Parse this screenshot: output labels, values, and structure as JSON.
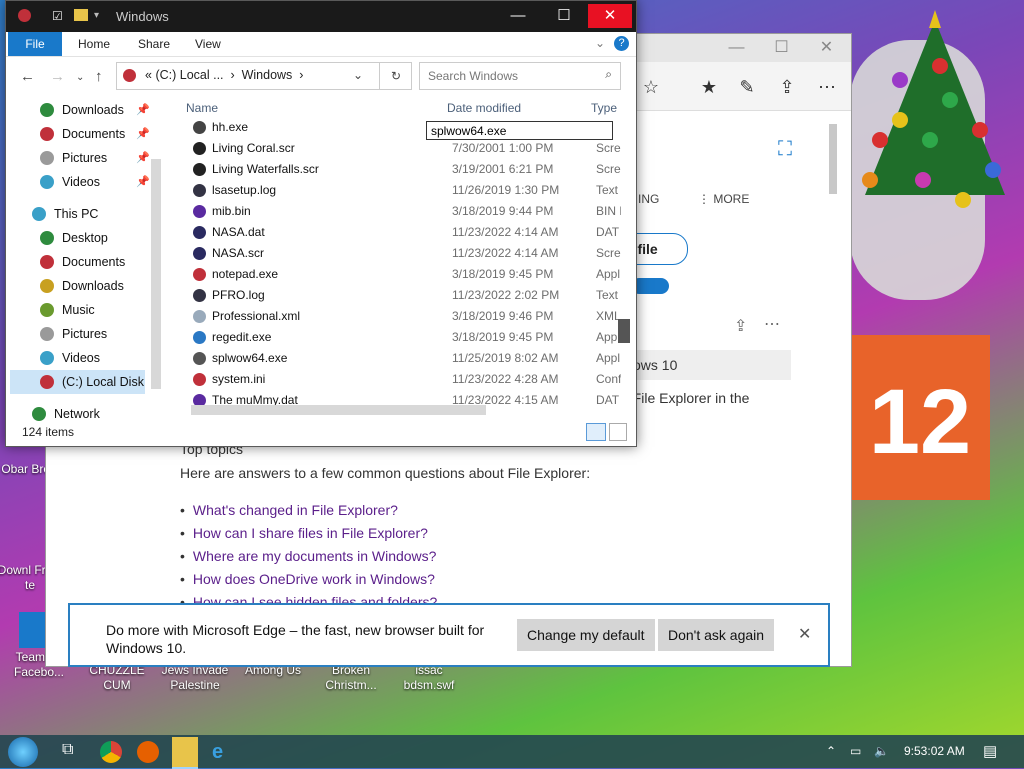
{
  "desktop": {
    "icons": [
      {
        "label": "Obar Brow"
      },
      {
        "label": "Downl From te"
      },
      {
        "label": "TeamOS Facebo..."
      },
      {
        "label": "CHUZZLE CUM"
      },
      {
        "label": "Jews Invade Palestine"
      },
      {
        "label": "Among Us"
      },
      {
        "label": "Broken Christm..."
      },
      {
        "label": "issac bdsm.swf"
      }
    ],
    "calendar_day": "12"
  },
  "edge": {
    "tab_more": "MORE",
    "tab_partial": "ING",
    "pill_partial": "lf file",
    "banner_partial": "ows 10",
    "content_partial": "e File Explorer in the",
    "top_topics": "Top topics",
    "answers": "Here are answers to a few common questions about File Explorer:",
    "links": [
      "What's changed in File Explorer?",
      "How can I share files in File Explorer?",
      "Where are my documents in Windows?",
      "How does OneDrive work in Windows?",
      "How can I see hidden files and folders?"
    ],
    "notification": {
      "message": "Do more with Microsoft Edge – the fast, new browser built for Windows 10.",
      "change_default": "Change my default",
      "dont_ask": "Don't ask again"
    }
  },
  "explorer": {
    "title": "Windows",
    "ribbon_tabs": [
      "File",
      "Home",
      "Share",
      "View"
    ],
    "address": {
      "prefix": "«",
      "part1": "(C:) Local ...",
      "sep": "›",
      "part2": "Windows"
    },
    "search_placeholder": "Search Windows",
    "nav": [
      {
        "label": "Downloads",
        "color": "#2e8b3e",
        "pinned": true
      },
      {
        "label": "Documents",
        "color": "#c0303a",
        "pinned": true
      },
      {
        "label": "Pictures",
        "color": "#9a9a9a",
        "pinned": true
      },
      {
        "label": "Videos",
        "color": "#3aa0c8",
        "pinned": true
      },
      {
        "label": "This PC",
        "color": "#3aa0c8",
        "pinned": false
      },
      {
        "label": "Desktop",
        "color": "#2e8b3e",
        "pinned": false
      },
      {
        "label": "Documents",
        "color": "#c0303a",
        "pinned": false
      },
      {
        "label": "Downloads",
        "color": "#c8a020",
        "pinned": false
      },
      {
        "label": "Music",
        "color": "#6a9a2e",
        "pinned": false
      },
      {
        "label": "Pictures",
        "color": "#9a9a9a",
        "pinned": false
      },
      {
        "label": "Videos",
        "color": "#3aa0c8",
        "pinned": false
      },
      {
        "label": "(C:) Local Disk",
        "color": "#c0303a",
        "pinned": false
      },
      {
        "label": "Network",
        "color": "#2e8b3e",
        "pinned": false
      }
    ],
    "columns": {
      "name": "Name",
      "date": "Date modified",
      "type": "Type"
    },
    "rename_value": "splwow64.exe",
    "files": [
      {
        "name": "hh.exe",
        "date": "",
        "type": "",
        "color": "#444"
      },
      {
        "name": "Living Coral.scr",
        "date": "7/30/2001 1:00 PM",
        "type": "Scree",
        "color": "#222"
      },
      {
        "name": "Living Waterfalls.scr",
        "date": "3/19/2001 6:21 PM",
        "type": "Scree",
        "color": "#222"
      },
      {
        "name": "lsasetup.log",
        "date": "11/26/2019 1:30 PM",
        "type": "Text",
        "color": "#334"
      },
      {
        "name": "mib.bin",
        "date": "3/18/2019 9:44 PM",
        "type": "BIN F",
        "color": "#5a2aa0"
      },
      {
        "name": "NASA.dat",
        "date": "11/23/2022 4:14 AM",
        "type": "DAT",
        "color": "#2a2a60"
      },
      {
        "name": "NASA.scr",
        "date": "11/23/2022 4:14 AM",
        "type": "Scree",
        "color": "#2a2a60"
      },
      {
        "name": "notepad.exe",
        "date": "3/18/2019 9:45 PM",
        "type": "Appl",
        "color": "#c0303a"
      },
      {
        "name": "PFRO.log",
        "date": "11/23/2022 2:02 PM",
        "type": "Text",
        "color": "#334"
      },
      {
        "name": "Professional.xml",
        "date": "3/18/2019 9:46 PM",
        "type": "XML",
        "color": "#9ab"
      },
      {
        "name": "regedit.exe",
        "date": "3/18/2019 9:45 PM",
        "type": "Appl",
        "color": "#2a78c4"
      },
      {
        "name": "splwow64.exe",
        "date": "11/25/2019 8:02 AM",
        "type": "Appl",
        "color": "#555"
      },
      {
        "name": "system.ini",
        "date": "11/23/2022 4:28 AM",
        "type": "Conf",
        "color": "#c0303a"
      },
      {
        "name": "The muMmy.dat",
        "date": "11/23/2022 4:15 AM",
        "type": "DAT",
        "color": "#5a2aa0"
      }
    ],
    "status": "124 items"
  },
  "taskbar": {
    "time": "9:53:02 AM"
  }
}
